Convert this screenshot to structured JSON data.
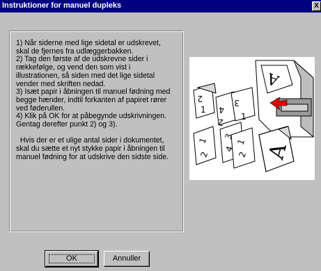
{
  "window": {
    "title": "Instruktioner for manuel dupleks",
    "close_glyph": "X"
  },
  "instructions": "1) Når siderne med lige sidetal er udskrevet,\nskal de fjernes fra udlæggerbakken.\n2) Tag den første af de udskrevne sider i\nrækkefølge, og vend den som vist i\nillustrationen, så siden med det lige sidetal\nvender med skriften nedad.\n3) Isæt papir i åbningen til manuel fødning med\nbegge hænder, indtil forkanten af papiret rører\nved føderullen.\n4) Klik på OK for at påbegynde udskrivningen.\nGentag derefter punkt 2) og 3).\n\n  Hvis der er et ulige antal sider i dokumentet,\nskal du sætte et nyt stykke papir i åbningen til\nmanuel fødning for at udskrive den sidste side.",
  "illustration": {
    "icon": "printer-duplex-illustration",
    "page_digits": [
      "2",
      "1",
      "4",
      "3",
      "1",
      "2",
      "3",
      "4",
      "A",
      "A"
    ]
  },
  "buttons": {
    "ok": "OK",
    "cancel": "Annuller"
  }
}
